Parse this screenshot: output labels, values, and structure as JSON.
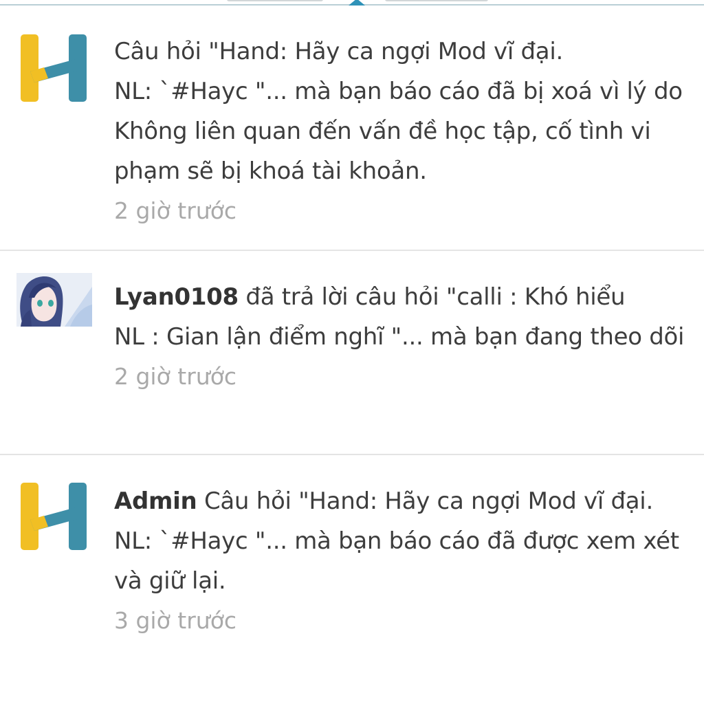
{
  "colors": {
    "logo_yellow": "#f1bf24",
    "logo_blue": "#3e8fa8",
    "time_gray": "#a9a9a9"
  },
  "notifications": [
    {
      "avatar_icon": "hoc24-logo-icon",
      "actor": "",
      "line1": "Câu hỏi \"Hand: Hãy ca ngợi Mod vĩ đại.",
      "line2": "NL: `#Hayc \"... mà bạn báo cáo đã bị xoá vì lý do Không liên quan đến vấn đề học tập, cố tình vi phạm sẽ bị khoá tài khoản.",
      "time": "2 giờ trước"
    },
    {
      "avatar_icon": "anime-user-avatar",
      "actor": "Lyan0108",
      "line1": " đã trả lời câu hỏi \"calli : Khó hiểu",
      "line2": "NL : Gian lận điểm nghĩ \"... mà bạn đang theo dõi",
      "time": "2 giờ trước"
    },
    {
      "avatar_icon": "hoc24-logo-icon",
      "actor": "Admin",
      "line1": " Câu hỏi \"Hand: Hãy ca ngợi Mod vĩ đại.",
      "line2": "NL: `#Hayc \"... mà bạn báo cáo đã được xem xét và giữ lại.",
      "time": "3 giờ trước"
    }
  ]
}
